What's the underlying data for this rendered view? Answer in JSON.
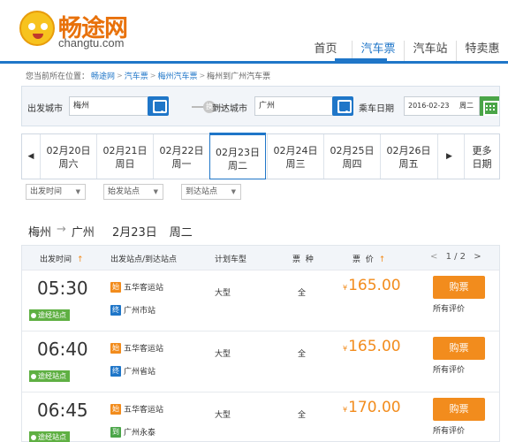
{
  "header": {
    "logo_cn": "畅途网",
    "logo_en": "changtu.com",
    "nav": [
      "首页",
      "汽车票",
      "汽车站",
      "特卖惠"
    ],
    "active_nav": 1
  },
  "breadcrumb": {
    "prefix": "您当前所在位置：",
    "items": [
      "畅途网",
      "汽车票",
      "梅州汽车票",
      "梅州到广州汽车票"
    ],
    "separator": ">"
  },
  "search": {
    "from_label": "出发城市",
    "from_value": "梅州",
    "swap_label": "换",
    "to_label": "到达城市",
    "to_value": "广州",
    "date_label": "乘车日期",
    "date_value": "2016-02-23",
    "weekday_value": "周二"
  },
  "date_tabs": {
    "prev_arrow": "◀",
    "next_arrow": "▶",
    "tabs": [
      {
        "date": "02月20日",
        "weekday": "周六"
      },
      {
        "date": "02月21日",
        "weekday": "周日"
      },
      {
        "date": "02月22日",
        "weekday": "周一"
      },
      {
        "date": "02月23日",
        "weekday": "周二"
      },
      {
        "date": "02月24日",
        "weekday": "周三"
      },
      {
        "date": "02月25日",
        "weekday": "周四"
      },
      {
        "date": "02月26日",
        "weekday": "周五"
      }
    ],
    "active_index": 3,
    "more_line1": "更多",
    "more_line2": "日期"
  },
  "filters": [
    {
      "label": "出发时间"
    },
    {
      "label": "始发站点"
    },
    {
      "label": "到达站点"
    }
  ],
  "route": {
    "from": "梅州",
    "arrow": "→",
    "to": "广州",
    "date": "2月23日",
    "weekday": "周二"
  },
  "table": {
    "headers": {
      "time": "出发时间",
      "stations": "出发站点/到达站点",
      "bus_type": "计划车型",
      "ticket_type": "票  种",
      "price": "票  价"
    },
    "pager": {
      "prev": "<",
      "text": "1 / 2",
      "next": ">"
    },
    "rows": [
      {
        "time": "05:30",
        "via": "途经站点",
        "start_badge": "始",
        "start": "五华客运站",
        "end_badge": "终",
        "end": "广州市站",
        "bus_type": "大型",
        "ticket_type": "全",
        "currency": "¥",
        "price": "165.00",
        "buy": "购票",
        "reviews": "所有评价"
      },
      {
        "time": "06:40",
        "via": "途经站点",
        "start_badge": "始",
        "start": "五华客运站",
        "end_badge": "终",
        "end": "广州省站",
        "bus_type": "大型",
        "ticket_type": "全",
        "currency": "¥",
        "price": "165.00",
        "buy": "购票",
        "reviews": "所有评价"
      },
      {
        "time": "06:45",
        "via": "途经站点",
        "start_badge": "始",
        "start": "五华客运站",
        "end_badge": "到",
        "end": "广州永泰",
        "bus_type": "大型",
        "ticket_type": "全",
        "currency": "¥",
        "price": "170.00",
        "buy": "购票",
        "reviews": "所有评价"
      }
    ]
  },
  "colors": {
    "brand_blue": "#1f76c8",
    "accent_orange": "#f28c1d",
    "via_green": "#5fb043"
  }
}
